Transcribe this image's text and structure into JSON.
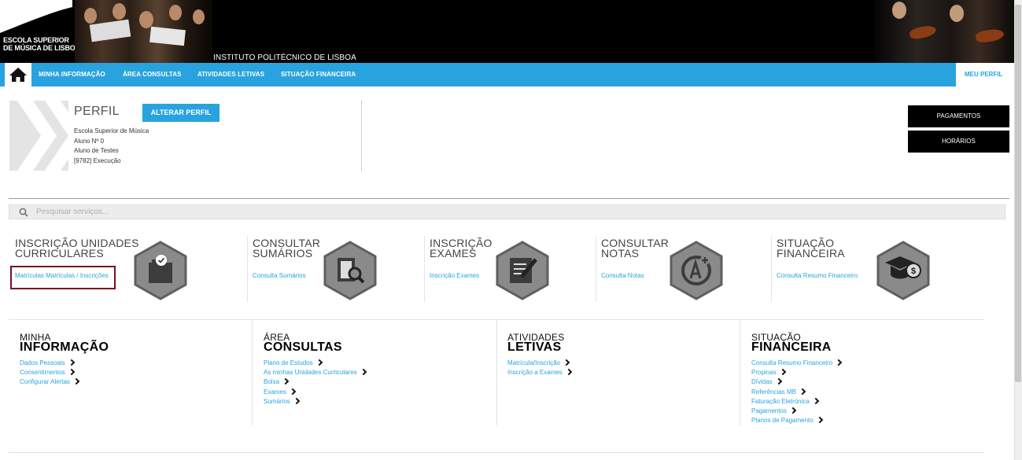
{
  "header": {
    "school_name_line1": "ESCOLA SUPERIOR",
    "school_name_line2": "DE MÚSICA DE LISBOA",
    "institute": "INSTITUTO POLITÉCNICO DE LISBOA"
  },
  "nav": {
    "items": [
      "MINHA INFORMAÇÃO",
      "ÁREA CONSULTAS",
      "ATIVIDADES LETIVAS",
      "SITUAÇÃO FINANCEIRA"
    ],
    "profile": "MEU PERFIL"
  },
  "profile": {
    "title": "PERFIL",
    "change_button": "ALTERAR PERFIL",
    "school": "Escola Superior de Música",
    "student_number": "Aluno Nº 0",
    "student_name": "Aluno de Testes",
    "course": "[9782] Execução"
  },
  "actions": {
    "payments": "PAGAMENTOS",
    "schedules": "HORÁRIOS"
  },
  "search": {
    "placeholder": "Pesquisar serviços..."
  },
  "tiles": [
    {
      "title_line1": "INSCRIÇÃO UNIDADES",
      "title_line2": "CURRICULARES",
      "link": "Matrículas Matrículas / Inscrições",
      "icon": "checklist-icon"
    },
    {
      "title_line1": "CONSULTAR",
      "title_line2": "SUMÁRIOS",
      "link": "Consulta Sumários",
      "icon": "document-search-icon"
    },
    {
      "title_line1": "INSCRIÇÃO",
      "title_line2": "EXAMES",
      "link": "Inscrição Exames",
      "icon": "exam-edit-icon"
    },
    {
      "title_line1": "CONSULTAR",
      "title_line2": "NOTAS",
      "link": "Consulta Notas",
      "icon": "grade-a-plus-icon"
    },
    {
      "title_line1": "SITUAÇÃO",
      "title_line2": "FINANCEIRA",
      "link": "Consulta Resumo Financeiro",
      "icon": "graduation-money-icon"
    }
  ],
  "columns": [
    {
      "small": "MINHA",
      "big": "INFORMAÇÃO",
      "links": [
        "Dados Pessoais",
        "Consentimentos",
        "Configurar Alertas"
      ]
    },
    {
      "small": "ÁREA",
      "big": "CONSULTAS",
      "links": [
        "Plano de Estudos",
        "As minhas Unidades Curriculares",
        "Bolsa",
        "Exames",
        "Sumários"
      ]
    },
    {
      "small": "ATIVIDADES",
      "big": "LETIVAS",
      "links": [
        "Matrícula/Inscrição",
        "Inscrição a Exames"
      ]
    },
    {
      "small": "SITUAÇÃO",
      "big": "FINANCEIRA",
      "links": [
        "Consulta Resumo Financeiro",
        "Propinas",
        "Dívidas",
        "Referências MB",
        "Faturação Eletrónica",
        "Pagamentos",
        "Planos de Pagamento"
      ]
    }
  ],
  "colors": {
    "accent": "#29a3df",
    "highlight_border": "#7a0f1f",
    "hex_fill": "#8a8a8a"
  }
}
